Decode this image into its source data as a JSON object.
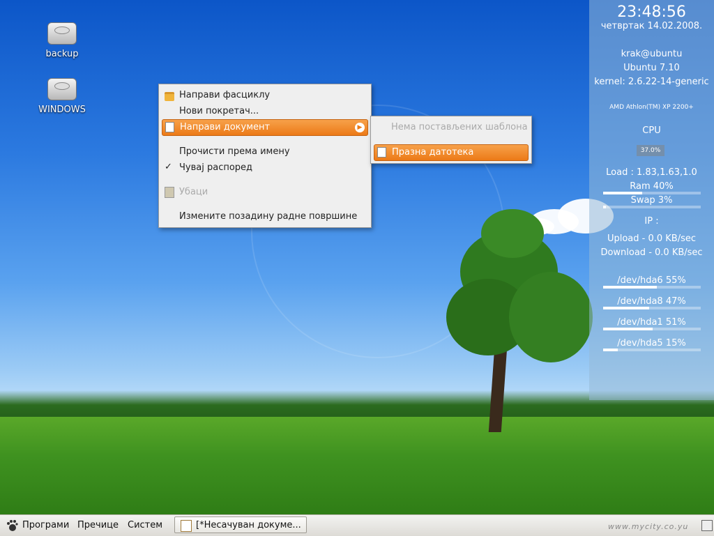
{
  "desktop": {
    "icons": [
      {
        "label": "backup",
        "icon": "hard-drive-icon"
      },
      {
        "label": "WINDOWS",
        "icon": "hard-drive-icon"
      }
    ]
  },
  "context_menu": {
    "items": [
      {
        "label": "Направи фасциклу",
        "icon": "folder-icon",
        "state": "normal"
      },
      {
        "label": "Нови покретач...",
        "icon": "",
        "state": "normal"
      },
      {
        "label": "Направи документ",
        "icon": "document-icon",
        "state": "highlighted",
        "submenu": true
      },
      {
        "label": "Прочисти према имену",
        "icon": "",
        "state": "normal"
      },
      {
        "label": "Чувај распоред",
        "icon": "check-icon",
        "state": "checked"
      },
      {
        "label": "Убаци",
        "icon": "paste-icon",
        "state": "disabled"
      },
      {
        "label": "Измените позадину радне површине",
        "icon": "",
        "state": "normal"
      }
    ],
    "submenu": {
      "items": [
        {
          "label": "Нема постављених шаблона",
          "state": "disabled"
        },
        {
          "label": "Празна датотека",
          "icon": "document-icon",
          "state": "highlighted"
        }
      ]
    }
  },
  "conky": {
    "time": "23:48:56",
    "date": "четвртак 14.02.2008.",
    "user": "krak@ubuntu",
    "os": "Ubuntu 7.10",
    "kernel": "kernel: 2.6.22-14-generic",
    "cpu_model": "AMD Athlon(TM) XP 2200+",
    "cpu_label": "CPU",
    "cpu_value": "37.0%",
    "load": "Load : 1.83,1.63,1.0",
    "ram": {
      "label": "Ram 40%",
      "fraction": 0.4
    },
    "swap": {
      "label": "Swap 3%",
      "fraction": 0.03
    },
    "ip": "IP :",
    "upload": "Upload - 0.0 KB/sec",
    "download": "Download - 0.0 KB/sec",
    "disks": [
      {
        "label": "/dev/hda6 55%",
        "fraction": 0.55
      },
      {
        "label": "/dev/hda8 47%",
        "fraction": 0.47
      },
      {
        "label": "/dev/hda1 51%",
        "fraction": 0.51
      },
      {
        "label": "/dev/hda5 15%",
        "fraction": 0.15
      }
    ]
  },
  "panel": {
    "menus": [
      "Програми",
      "Пречице",
      "Систем"
    ],
    "task": {
      "label": "[*Несачуван докуме...",
      "icon": "text-editor-icon"
    },
    "watermark": "www.mycity.co.yu"
  }
}
